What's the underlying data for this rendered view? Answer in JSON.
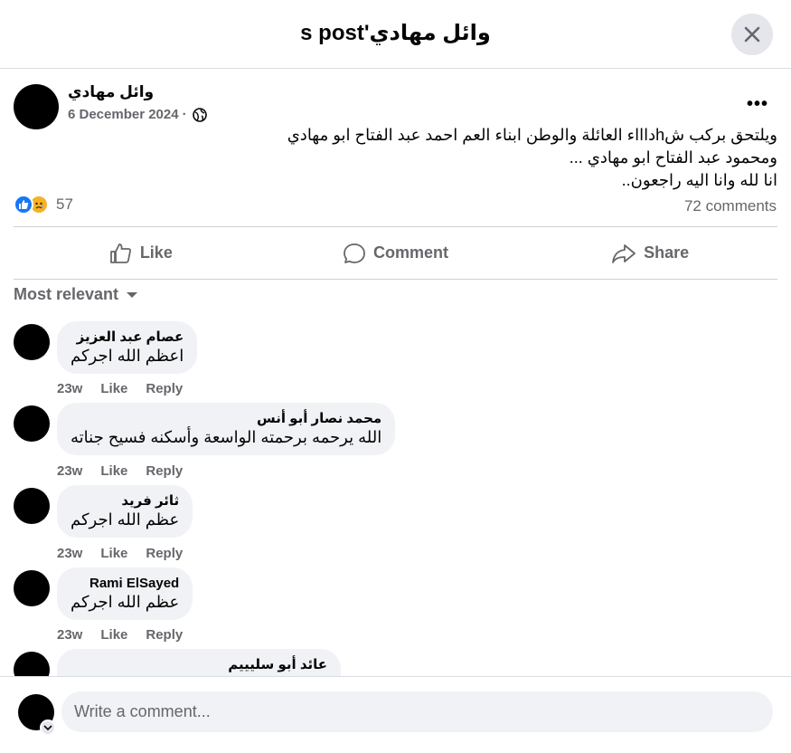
{
  "dialog": {
    "title": "s post'وائل مهادي"
  },
  "post": {
    "author": "وائل مهادي",
    "date": "6 December 2024",
    "date_separator": "·",
    "privacy_icon": "globe-icon",
    "more_label": "•••",
    "text_lines": [
      "ويلتحق بركب شhداااء العائلة والوطن ابناء العم احمد عبد الفتاح ابو مهادي",
      "ومحمود عبد الفتاح ابو مهادي ...",
      "انا لله وانا اليه راجعون.."
    ],
    "reaction_count": "57",
    "comments_count": "72 comments"
  },
  "actions": {
    "like": "Like",
    "comment": "Comment",
    "share": "Share"
  },
  "sort": {
    "label": "Most relevant"
  },
  "comments": [
    {
      "author": "عصام عبد العزيز",
      "text": "اعظم الله اجركم",
      "time": "23w",
      "like": "Like",
      "reply": "Reply"
    },
    {
      "author": "محمد نصار أبو أنس",
      "text": "الله يرحمه برحمته الواسعة وأسكنه فسيح جناته",
      "time": "23w",
      "like": "Like",
      "reply": "Reply"
    },
    {
      "author": "ثائر فريد",
      "text": "عظم الله اجركم",
      "time": "23w",
      "like": "Like",
      "reply": "Reply"
    },
    {
      "author": "Rami ElSayed",
      "text": "عظم الله اجركم",
      "time": "23w",
      "like": "Like",
      "reply": "Reply"
    },
    {
      "author": "عائد أبو سليييم",
      "text": "",
      "time": "",
      "like": "",
      "reply": ""
    }
  ],
  "composer": {
    "placeholder": "Write a comment..."
  },
  "colors": {
    "brand_blue": "#1877f2",
    "muted_text": "#65676b",
    "bubble_bg": "#f0f2f5",
    "divider": "#ced0d4"
  }
}
